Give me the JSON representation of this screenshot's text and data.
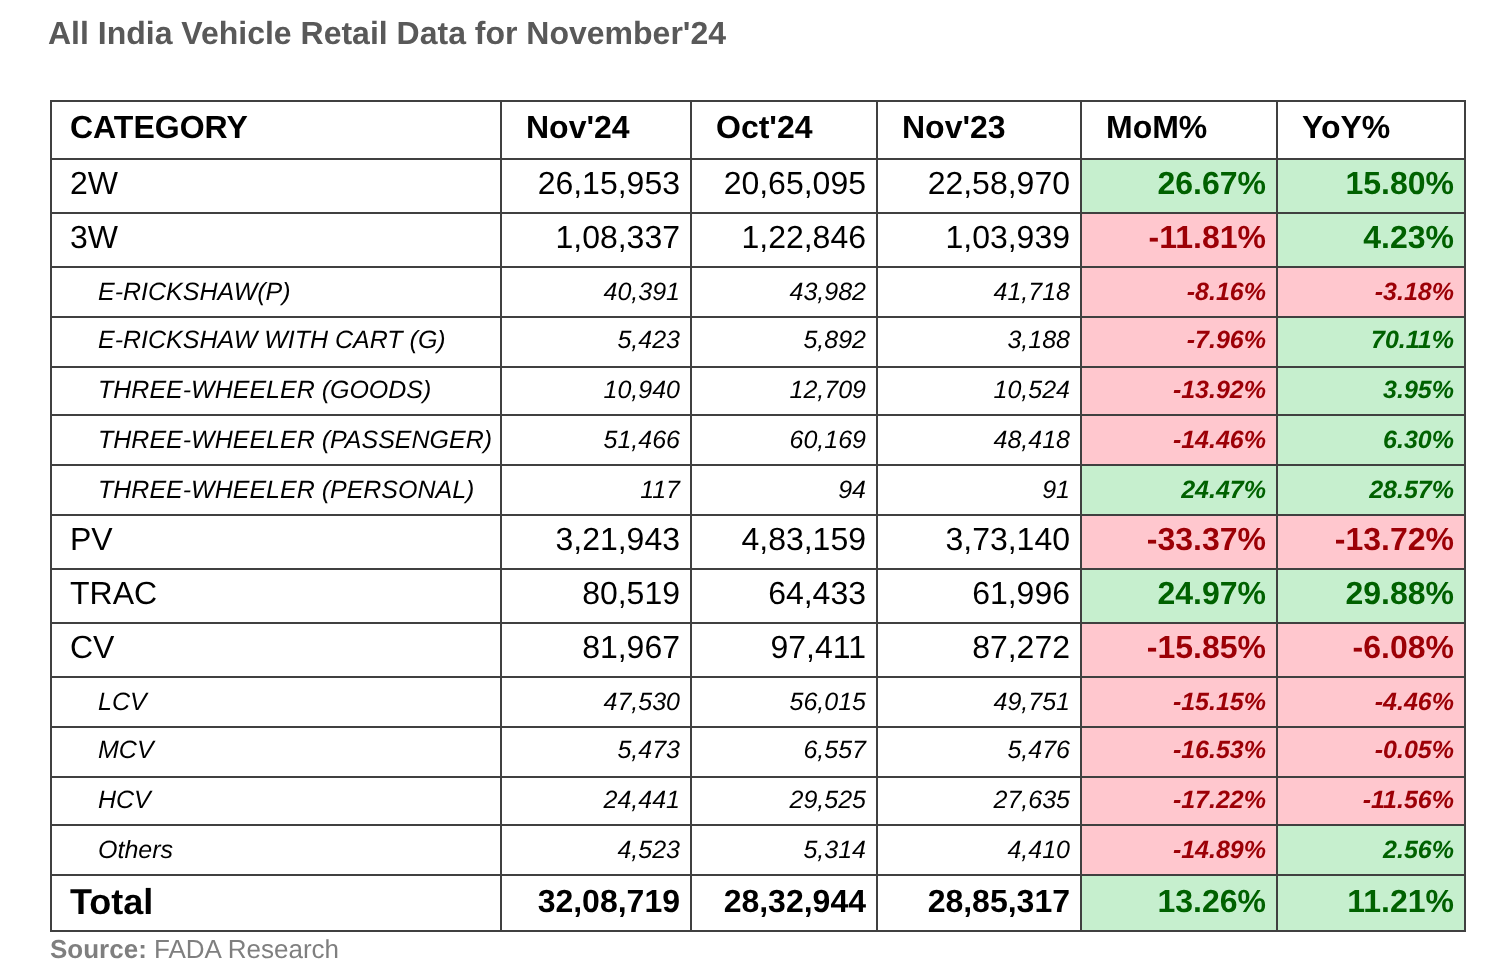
{
  "title": "All India Vehicle Retail Data for November'24",
  "table": {
    "columns": [
      "CATEGORY",
      "Nov'24",
      "Oct'24",
      "Nov'23",
      "MoM%",
      "YoY%"
    ],
    "rows": [
      {
        "kind": "main",
        "category": "2W",
        "values": [
          "26,15,953",
          "20,65,095",
          "22,58,970"
        ],
        "mom": {
          "text": "26.67%",
          "positive": true
        },
        "yoy": {
          "text": "15.80%",
          "positive": true
        }
      },
      {
        "kind": "main",
        "category": "3W",
        "values": [
          "1,08,337",
          "1,22,846",
          "1,03,939"
        ],
        "mom": {
          "text": "-11.81%",
          "positive": false
        },
        "yoy": {
          "text": "4.23%",
          "positive": true
        }
      },
      {
        "kind": "sub",
        "category": "E-RICKSHAW(P)",
        "values": [
          "40,391",
          "43,982",
          "41,718"
        ],
        "mom": {
          "text": "-8.16%",
          "positive": false
        },
        "yoy": {
          "text": "-3.18%",
          "positive": false
        }
      },
      {
        "kind": "sub",
        "category": "E-RICKSHAW WITH CART (G)",
        "values": [
          "5,423",
          "5,892",
          "3,188"
        ],
        "mom": {
          "text": "-7.96%",
          "positive": false
        },
        "yoy": {
          "text": "70.11%",
          "positive": true
        }
      },
      {
        "kind": "sub",
        "category": "THREE-WHEELER (GOODS)",
        "values": [
          "10,940",
          "12,709",
          "10,524"
        ],
        "mom": {
          "text": "-13.92%",
          "positive": false
        },
        "yoy": {
          "text": "3.95%",
          "positive": true
        }
      },
      {
        "kind": "sub",
        "category": "THREE-WHEELER (PASSENGER)",
        "values": [
          "51,466",
          "60,169",
          "48,418"
        ],
        "mom": {
          "text": "-14.46%",
          "positive": false
        },
        "yoy": {
          "text": "6.30%",
          "positive": true
        }
      },
      {
        "kind": "sub",
        "category": "THREE-WHEELER (PERSONAL)",
        "values": [
          "117",
          "94",
          "91"
        ],
        "mom": {
          "text": "24.47%",
          "positive": true
        },
        "yoy": {
          "text": "28.57%",
          "positive": true
        }
      },
      {
        "kind": "main",
        "category": "PV",
        "values": [
          "3,21,943",
          "4,83,159",
          "3,73,140"
        ],
        "mom": {
          "text": "-33.37%",
          "positive": false
        },
        "yoy": {
          "text": "-13.72%",
          "positive": false
        }
      },
      {
        "kind": "main",
        "category": "TRAC",
        "values": [
          "80,519",
          "64,433",
          "61,996"
        ],
        "mom": {
          "text": "24.97%",
          "positive": true
        },
        "yoy": {
          "text": "29.88%",
          "positive": true
        }
      },
      {
        "kind": "main",
        "category": "CV",
        "values": [
          "81,967",
          "97,411",
          "87,272"
        ],
        "mom": {
          "text": "-15.85%",
          "positive": false
        },
        "yoy": {
          "text": "-6.08%",
          "positive": false
        }
      },
      {
        "kind": "sub",
        "category": "LCV",
        "values": [
          "47,530",
          "56,015",
          "49,751"
        ],
        "mom": {
          "text": "-15.15%",
          "positive": false
        },
        "yoy": {
          "text": "-4.46%",
          "positive": false
        }
      },
      {
        "kind": "sub",
        "category": "MCV",
        "values": [
          "5,473",
          "6,557",
          "5,476"
        ],
        "mom": {
          "text": "-16.53%",
          "positive": false
        },
        "yoy": {
          "text": "-0.05%",
          "positive": false
        }
      },
      {
        "kind": "sub",
        "category": "HCV",
        "values": [
          "24,441",
          "29,525",
          "27,635"
        ],
        "mom": {
          "text": "-17.22%",
          "positive": false
        },
        "yoy": {
          "text": "-11.56%",
          "positive": false
        }
      },
      {
        "kind": "sub",
        "category": "Others",
        "values": [
          "4,523",
          "5,314",
          "4,410"
        ],
        "mom": {
          "text": "-14.89%",
          "positive": false
        },
        "yoy": {
          "text": "2.56%",
          "positive": true
        }
      },
      {
        "kind": "total",
        "category": "Total",
        "values": [
          "32,08,719",
          "28,32,944",
          "28,85,317"
        ],
        "mom": {
          "text": "13.26%",
          "positive": true
        },
        "yoy": {
          "text": "11.21%",
          "positive": true
        }
      }
    ]
  },
  "source": "**Source:** FADA Research"
}
